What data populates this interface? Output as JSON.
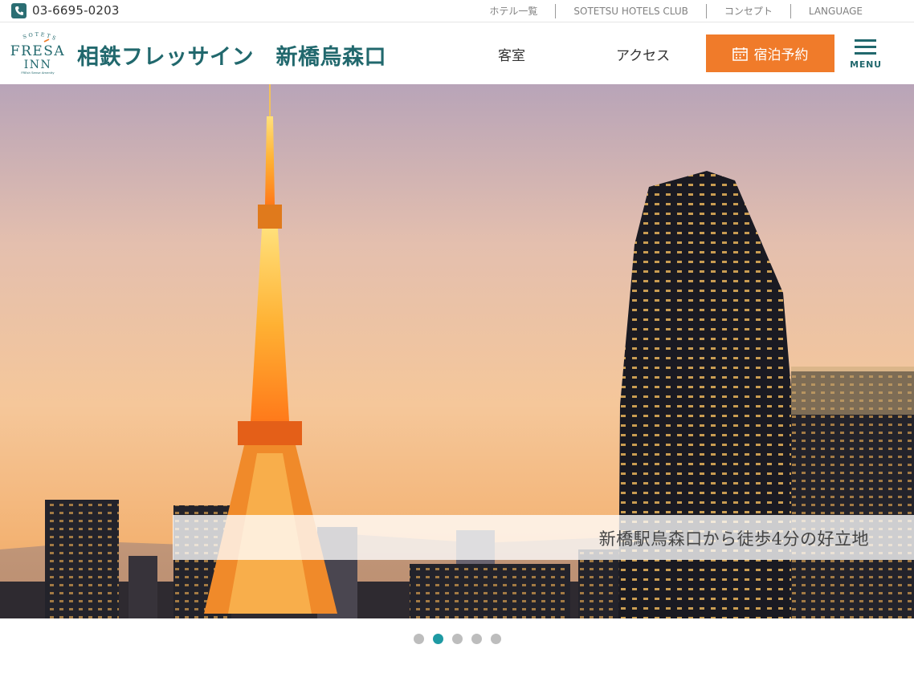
{
  "topbar": {
    "phone": "03-6695-0203",
    "phone_icon": "phone-icon",
    "links": [
      {
        "label": "ホテル一覧"
      },
      {
        "label": "SOTETSU HOTELS CLUB"
      },
      {
        "label": "コンセプト"
      },
      {
        "label": "LANGUAGE"
      }
    ]
  },
  "header": {
    "logo": {
      "arc_text": "SOTETSU",
      "line1": "FRESA",
      "line2": "INN",
      "tagline": "FREsh Sense Amenity"
    },
    "hotel_name": "相鉄フレッサイン　新橋烏森口",
    "nav": {
      "rooms": "客室",
      "access": "アクセス"
    },
    "reserve_label": "宿泊予約",
    "reserve_icon": "calendar-icon",
    "menu_label": "MENU",
    "brand_color": "#21686d",
    "accent_color": "#f07b2a"
  },
  "hero": {
    "caption": "新橋駅烏森口から徒歩4分の好立地"
  },
  "carousel": {
    "slide_count": 5,
    "active_index": 1,
    "active_color": "#1e9aa3"
  }
}
